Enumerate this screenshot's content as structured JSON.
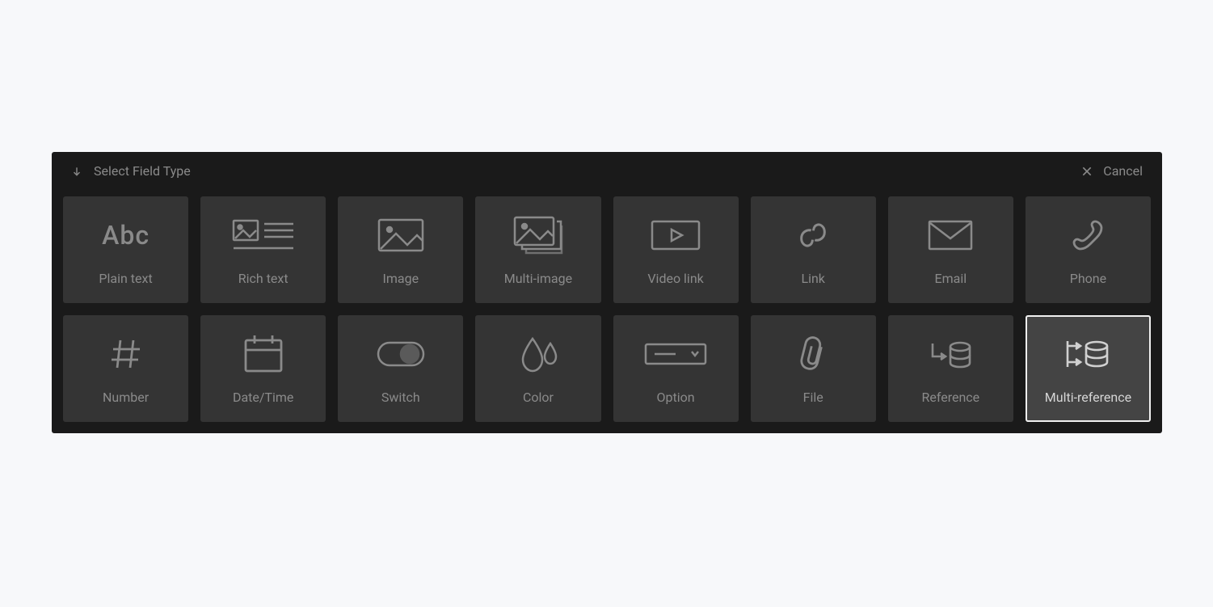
{
  "header": {
    "title": "Select Field Type",
    "cancel": "Cancel"
  },
  "fields": [
    {
      "id": "plain-text",
      "label": "Plain text",
      "icon": "abc",
      "selected": false
    },
    {
      "id": "rich-text",
      "label": "Rich text",
      "icon": "richtext",
      "selected": false
    },
    {
      "id": "image",
      "label": "Image",
      "icon": "image",
      "selected": false
    },
    {
      "id": "multi-image",
      "label": "Multi-image",
      "icon": "multi-image",
      "selected": false
    },
    {
      "id": "video-link",
      "label": "Video link",
      "icon": "video",
      "selected": false
    },
    {
      "id": "link",
      "label": "Link",
      "icon": "link",
      "selected": false
    },
    {
      "id": "email",
      "label": "Email",
      "icon": "email",
      "selected": false
    },
    {
      "id": "phone",
      "label": "Phone",
      "icon": "phone",
      "selected": false
    },
    {
      "id": "number",
      "label": "Number",
      "icon": "hash",
      "selected": false
    },
    {
      "id": "date-time",
      "label": "Date/Time",
      "icon": "calendar",
      "selected": false
    },
    {
      "id": "switch",
      "label": "Switch",
      "icon": "switch",
      "selected": false
    },
    {
      "id": "color",
      "label": "Color",
      "icon": "drops",
      "selected": false
    },
    {
      "id": "option",
      "label": "Option",
      "icon": "option",
      "selected": false
    },
    {
      "id": "file",
      "label": "File",
      "icon": "paperclip",
      "selected": false
    },
    {
      "id": "reference",
      "label": "Reference",
      "icon": "reference",
      "selected": false
    },
    {
      "id": "multi-reference",
      "label": "Multi-reference",
      "icon": "multi-reference",
      "selected": true
    }
  ]
}
